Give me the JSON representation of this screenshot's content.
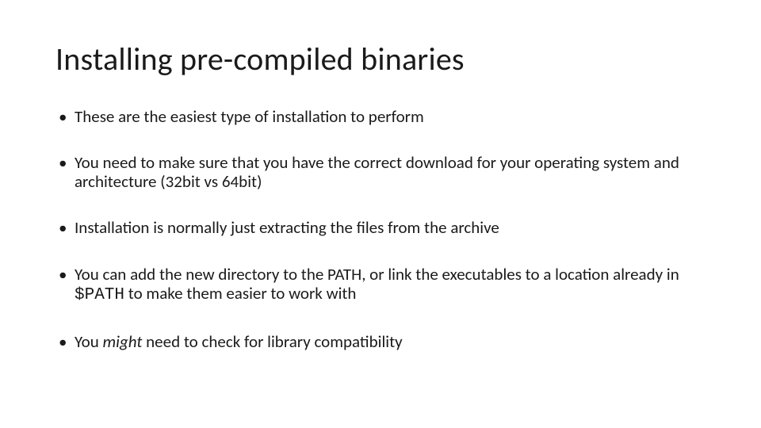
{
  "title": "Installing pre-compiled binaries",
  "bullets": {
    "b1": "These are the easiest type of installation to perform",
    "b2": "You need to make sure that you have the correct download for your operating system and architecture (32bit vs 64bit)",
    "b3": "Installation is normally just extracting the files from the archive",
    "b4_pre": "You can add the new directory to the PATH, or link the executables to a location already in ",
    "b4_code": "$PATH",
    "b4_post": " to make them easier to work with",
    "b5_pre": "You ",
    "b5_em": "might",
    "b5_post": " need to check for library compatibility"
  }
}
